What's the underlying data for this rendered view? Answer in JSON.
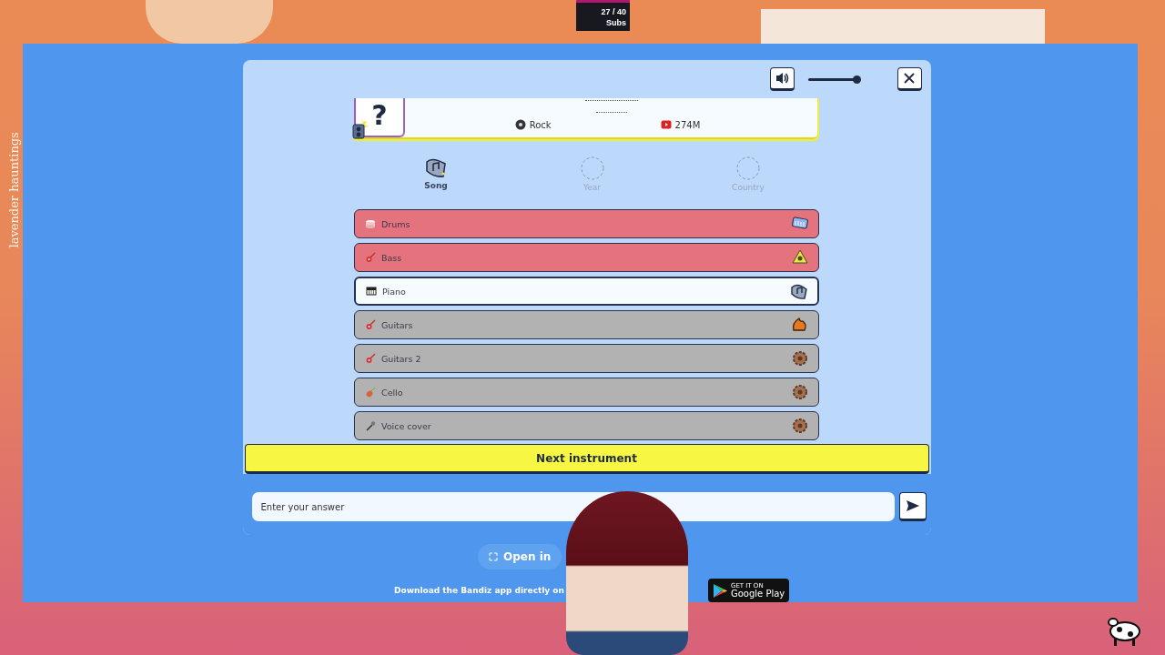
{
  "stream_overlay": {
    "sub_count": "27 / 40",
    "sub_label": "Subs",
    "side_text": "lavender hauntings"
  },
  "modal": {
    "volume": {
      "level": 0.92
    },
    "song_card": {
      "cover_text": "?",
      "genre": "Rock",
      "views": "274M"
    },
    "hints": [
      {
        "label": "Song",
        "revealed": true
      },
      {
        "label": "Year",
        "revealed": false
      },
      {
        "label": "Country",
        "revealed": false
      }
    ],
    "instruments": [
      {
        "label": "Drums",
        "kind": "wrong"
      },
      {
        "label": "Bass",
        "kind": "wrong"
      },
      {
        "label": "Piano",
        "kind": "current"
      },
      {
        "label": "Guitars",
        "kind": "locked"
      },
      {
        "label": "Guitars 2",
        "kind": "locked"
      },
      {
        "label": "Cello",
        "kind": "locked"
      },
      {
        "label": "Voice cover",
        "kind": "locked"
      }
    ],
    "next_button": "Next instrument",
    "answer": {
      "placeholder": "Enter your answer"
    }
  },
  "footer": {
    "open_button": "Open in",
    "download_text": "Download the Bandiz app directly on",
    "store_badge": {
      "small": "GET IT ON",
      "large": "Google Play"
    }
  }
}
